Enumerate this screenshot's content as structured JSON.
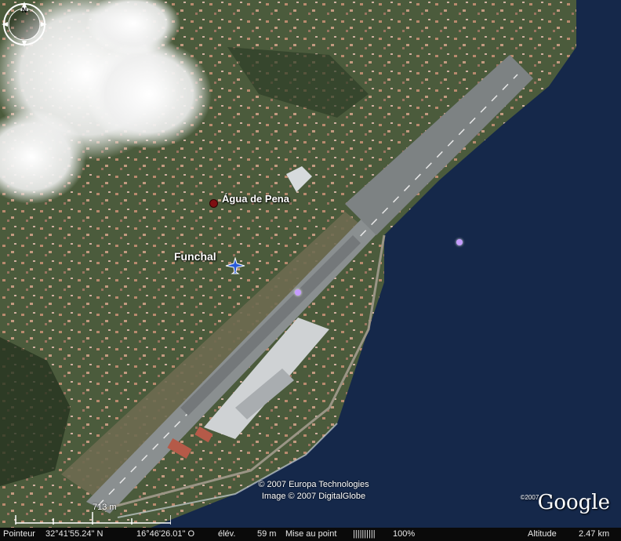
{
  "map": {
    "place_label": "Água de Pena",
    "city_label": "Funchal",
    "copyright_line1": "© 2007 Europa Technologies",
    "copyright_line2": "Image © 2007 DigitalGlobe",
    "logo_prefix": "©2007",
    "logo": "Google",
    "compass_letter": "N",
    "scale_label": "713 m",
    "icons": [
      "airport-plane-icon",
      "compass-icon",
      "placemark-icon"
    ]
  },
  "status": {
    "pointer_label": "Pointeur",
    "lat": "32°41'55.24\" N",
    "lon": "16°46'26.01\" O",
    "elev_label": "élév.",
    "elev": "59 m",
    "stream_label": "Mise au point",
    "stream_bars": "||||||||||",
    "stream_pct": "100%",
    "alt_label": "Altitude",
    "alt": "2.47 km"
  },
  "colors": {
    "sea": "#15284a",
    "land": "#4a5a3a",
    "runway": "#8a8f90",
    "apron": "#cfd2d4"
  }
}
